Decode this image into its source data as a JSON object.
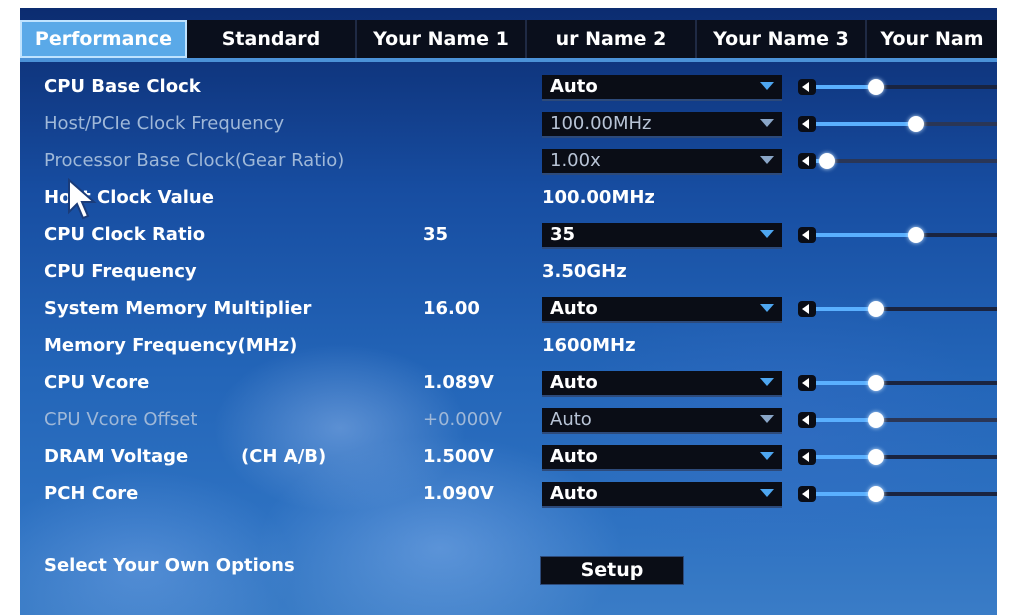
{
  "tabs": [
    {
      "label": "Performance",
      "active": true
    },
    {
      "label": "Standard",
      "active": false
    },
    {
      "label": "Your Name 1",
      "active": false
    },
    {
      "label": "ur Name 2",
      "active": false
    },
    {
      "label": "Your Name 3",
      "active": false
    },
    {
      "label": "Your Nam",
      "active": false
    }
  ],
  "colors": {
    "accent": "#5aa9e8",
    "background": "#174da1",
    "control": "#0a0d16",
    "dimmed_text": "#9fb8d8"
  },
  "rows": {
    "cpu_base_clock": {
      "label": "CPU Base Clock",
      "dropdown": "Auto",
      "slider_level": 0.33
    },
    "host_pcie_freq": {
      "label": "Host/PCIe Clock Frequency",
      "dropdown": "100.00MHz",
      "slider_level": 0.55
    },
    "processor_base_clock": {
      "label": "Processor Base Clock(Gear Ratio)",
      "dropdown": "1.00x",
      "slider_level": 0.06
    },
    "host_clock_value": {
      "label": "Host Clock Value",
      "value": "100.00MHz"
    },
    "cpu_clock_ratio": {
      "label": "CPU Clock Ratio",
      "current": "35",
      "dropdown": "35",
      "slider_level": 0.55
    },
    "cpu_frequency": {
      "label": "CPU Frequency",
      "value": "3.50GHz"
    },
    "memory_multiplier": {
      "label": "System Memory Multiplier",
      "current": "16.00",
      "dropdown": "Auto",
      "slider_level": 0.33
    },
    "memory_frequency": {
      "label": "Memory Frequency(MHz)",
      "value": "1600MHz"
    },
    "cpu_vcore": {
      "label": "CPU Vcore",
      "current": "1.089V",
      "dropdown": "Auto",
      "slider_level": 0.33
    },
    "cpu_vcore_offset": {
      "label": "CPU Vcore Offset",
      "current": "+0.000V",
      "dropdown": "Auto",
      "slider_level": 0.33
    },
    "dram_voltage": {
      "label": "DRAM Voltage",
      "sub": "(CH A/B)",
      "current": "1.500V",
      "dropdown": "Auto",
      "slider_level": 0.33
    },
    "pch_core": {
      "label": "PCH Core",
      "current": "1.090V",
      "dropdown": "Auto",
      "slider_level": 0.33
    }
  },
  "footer": {
    "label": "Select Your Own Options",
    "button": "Setup"
  }
}
